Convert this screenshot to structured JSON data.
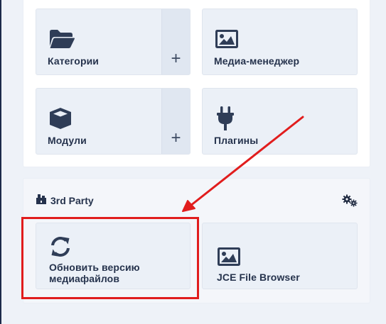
{
  "tiles_top": [
    {
      "label": "Категории",
      "icon": "folder-open-icon",
      "has_add": true
    },
    {
      "label": "Медиа-менеджер",
      "icon": "image-icon",
      "has_add": false
    },
    {
      "label": "Модули",
      "icon": "cube-icon",
      "has_add": true
    },
    {
      "label": "Плагины",
      "icon": "plug-icon",
      "has_add": false
    }
  ],
  "add_symbol": "+",
  "third_party": {
    "title": "3rd Party",
    "icon": "puzzle-icon",
    "settings_icon": "gears-icon",
    "tiles": [
      {
        "label_line1": "Обновить версию",
        "label_line2": "медиафайлов",
        "icon": "sync-icon"
      },
      {
        "label": "JCE File Browser",
        "icon": "image-icon"
      }
    ]
  },
  "colors": {
    "accent_dark": "#26334d",
    "highlight_red": "#e11d1d",
    "tile_bg": "#ebf0f7"
  }
}
